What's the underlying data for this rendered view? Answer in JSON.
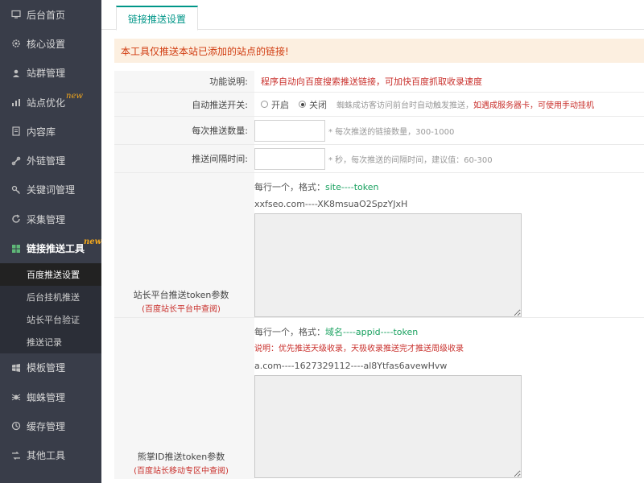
{
  "sidebar": {
    "items": [
      {
        "icon": "monitor-icon",
        "label": "后台首页"
      },
      {
        "icon": "gear-icon",
        "label": "核心设置"
      },
      {
        "icon": "user-icon",
        "label": "站群管理"
      },
      {
        "icon": "chart-icon",
        "label": "站点优化",
        "badge": "new"
      },
      {
        "icon": "document-icon",
        "label": "内容库"
      },
      {
        "icon": "link-icon",
        "label": "外链管理"
      },
      {
        "icon": "key-icon",
        "label": "关键词管理"
      },
      {
        "icon": "refresh-icon",
        "label": "采集管理"
      },
      {
        "icon": "grid-icon",
        "label": "链接推送工具",
        "badge": "new"
      }
    ],
    "sub_items": [
      {
        "label": "百度推送设置"
      },
      {
        "label": "后台挂机推送"
      },
      {
        "label": "站长平台验证"
      },
      {
        "label": "推送记录"
      }
    ],
    "bottom_items": [
      {
        "icon": "windows-icon",
        "label": "模板管理"
      },
      {
        "icon": "spider-icon",
        "label": "蜘蛛管理"
      },
      {
        "icon": "database-icon",
        "label": "缓存管理"
      },
      {
        "icon": "tools-icon",
        "label": "其他工具"
      }
    ]
  },
  "tab": {
    "label": "链接推送设置"
  },
  "notice": "本工具仅推送本站已添加的站点的链接!",
  "form": {
    "description": {
      "label": "功能说明:",
      "text": "程序自动向百度搜索推送链接，可加快百度抓取收录速度"
    },
    "auto_push": {
      "label": "自动推送开关:",
      "option_on": "开启",
      "option_off": "关闭",
      "selected": "off",
      "hint_gray": "蜘蛛成访客访问前台时自动触发推送，",
      "hint_red": "如遇成服务器卡，可使用手动挂机"
    },
    "push_count": {
      "label": "每次推送数量:",
      "value": "",
      "hint": "* 每次推送的链接数量，300-1000"
    },
    "push_interval": {
      "label": "推送间隔时间:",
      "value": "",
      "hint": "* 秒，每次推送的间隔时间，建议值：60-300"
    },
    "webmaster_token": {
      "label": "站长平台推送token参数",
      "sublabel": "(百度站长平台中查阅)",
      "format_prefix": "每行一个，格式：",
      "format_value": "site----token",
      "example": "xxfseo.com----XK8msuaO2SpzYJxH",
      "value": ""
    },
    "xiongzhang_token": {
      "label": "熊掌ID推送token参数",
      "sublabel": "(百度站长移动专区中查阅)",
      "format_prefix": "每行一个，格式：",
      "format_value": "域名----appid----token",
      "note": "说明：优先推送天级收录，天极收录推送完才推送周级收录",
      "example": "a.com----1627329112----al8Ytfas6avewHvw",
      "value": ""
    }
  }
}
